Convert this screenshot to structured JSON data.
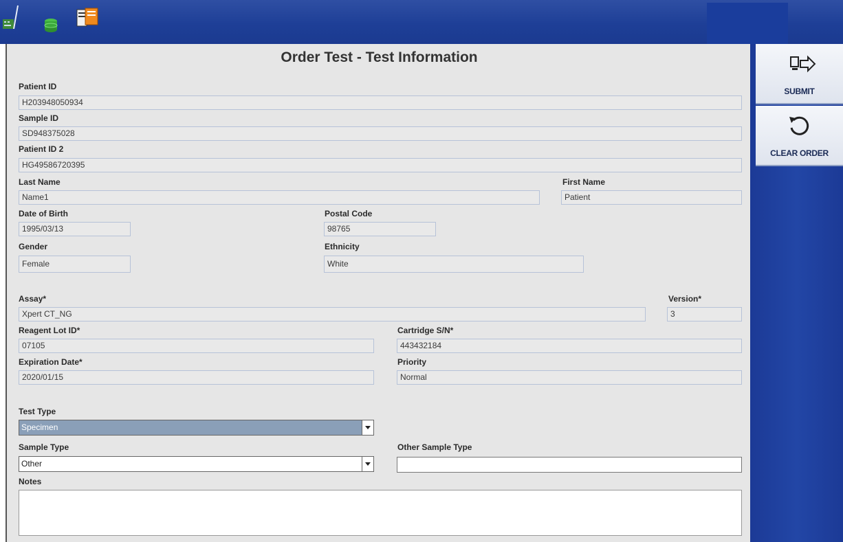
{
  "title": "Order Test - Test Information",
  "sidebar": {
    "submit_label": "SUBMIT",
    "clear_label": "CLEAR ORDER"
  },
  "fields": {
    "patient_id": {
      "label": "Patient ID",
      "value": "H203948050934"
    },
    "sample_id": {
      "label": "Sample ID",
      "value": "SD948375028"
    },
    "patient_id_2": {
      "label": "Patient ID 2",
      "value": "HG49586720395"
    },
    "last_name": {
      "label": "Last Name",
      "value": "Name1"
    },
    "first_name": {
      "label": "First Name",
      "value": "Patient"
    },
    "dob": {
      "label": "Date of Birth",
      "value": "1995/03/13"
    },
    "postal_code": {
      "label": "Postal Code",
      "value": "98765"
    },
    "gender": {
      "label": "Gender",
      "value": "Female"
    },
    "ethnicity": {
      "label": "Ethnicity",
      "value": "White"
    },
    "assay": {
      "label": "Assay*",
      "value": "Xpert CT_NG"
    },
    "version": {
      "label": "Version*",
      "value": "3"
    },
    "reagent_lot": {
      "label": "Reagent Lot ID*",
      "value": "07105"
    },
    "cartridge_sn": {
      "label": "Cartridge S/N*",
      "value": "443432184"
    },
    "expiration": {
      "label": "Expiration Date*",
      "value": "2020/01/15"
    },
    "priority": {
      "label": "Priority",
      "value": "Normal"
    },
    "test_type": {
      "label": "Test Type",
      "value": "Specimen"
    },
    "sample_type": {
      "label": "Sample Type",
      "value": "Other"
    },
    "other_sample_type": {
      "label": "Other Sample Type",
      "value": ""
    },
    "notes": {
      "label": "Notes",
      "value": ""
    }
  },
  "colors": {
    "selected_bg": "#8a9fb8",
    "topbar": "#1e3f97"
  }
}
